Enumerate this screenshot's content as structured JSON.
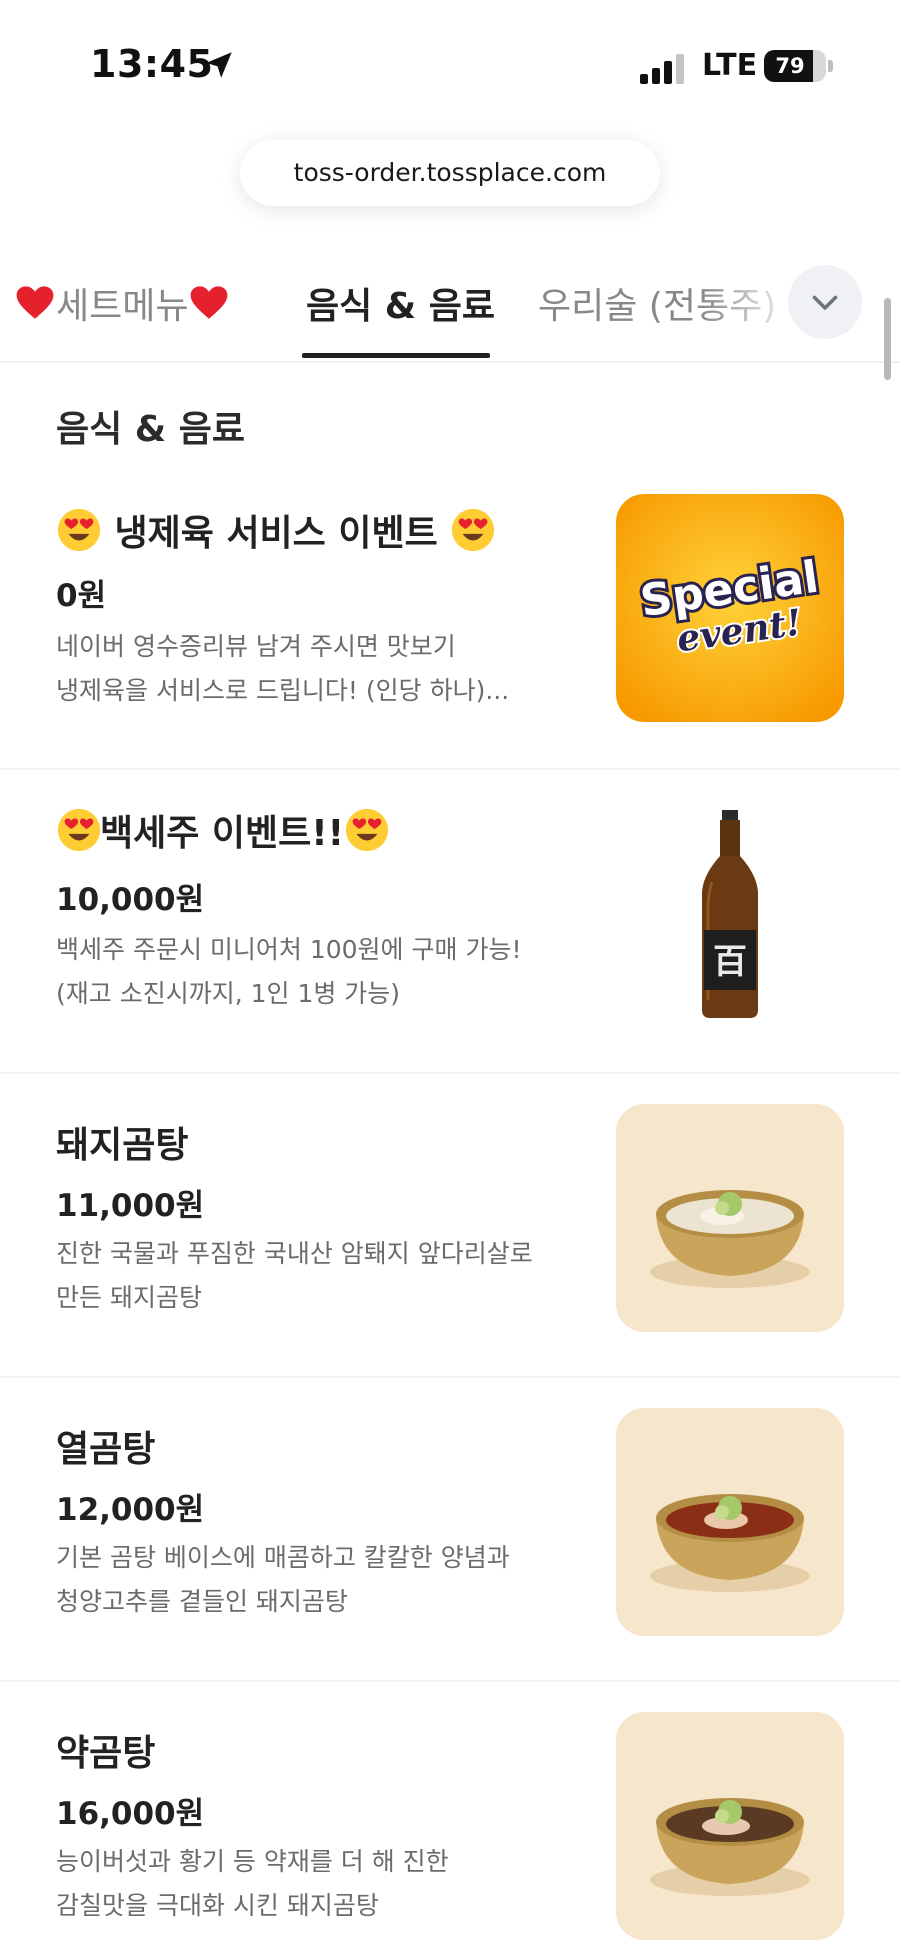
{
  "status": {
    "time": "13:45",
    "network": "LTE",
    "battery": "79",
    "battery_level": 0.79
  },
  "browser": {
    "url": "toss-order.tossplace.com"
  },
  "tabs": [
    {
      "label": "세트메뉴",
      "active": false
    },
    {
      "label": "음식 & 음료",
      "active": true
    },
    {
      "label": "우리술 (전통주)",
      "active": false
    }
  ],
  "section": {
    "title": "음식 & 음료"
  },
  "menu_items": [
    {
      "name": "냉제육 서비스 이벤트",
      "price": "0원",
      "desc_line1": "네이버 영수증리뷰 남겨 주시면 맛보기",
      "desc_line2": "냉제육을 서비스로 드립니다! (인당 하나)...",
      "image_text1": "Special",
      "image_text2": "event!"
    },
    {
      "name": "백세주 이벤트!!",
      "price": "10,000원",
      "desc_line1": "백세주 주문시 미니어처 100원에 구매 가능!",
      "desc_line2": "(재고 소진시까지, 1인 1병 가능)",
      "image_text1": "百"
    },
    {
      "name": "돼지곰탕",
      "price": "11,000원",
      "desc_line1": "진한 국물과 푸짐한 국내산 암퇘지 앞다리살로",
      "desc_line2": "만든 돼지곰탕"
    },
    {
      "name": "열곰탕",
      "price": "12,000원",
      "desc_line1": "기본 곰탕 베이스에 매콤하고 칼칼한 양념과",
      "desc_line2": "청양고추를 곁들인 돼지곰탕"
    },
    {
      "name": "약곰탕",
      "price": "16,000원",
      "desc_line1": "능이버섯과 황기 등 약재를 더 해 진한",
      "desc_line2": "감칠맛을 극대화 시킨 돼지곰탕"
    }
  ],
  "colors": {
    "heart": "#e5212e",
    "active_tab": "#222222",
    "inactive_tab": "#888888",
    "description": "#6b6b6b",
    "special_bg": "#f7a600"
  }
}
